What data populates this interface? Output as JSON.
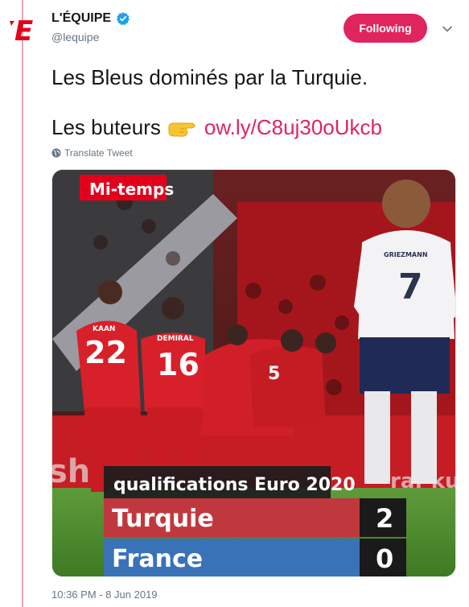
{
  "account": {
    "name": "L'ÉQUIPE",
    "handle": "@lequipe",
    "logo_text": "E",
    "verified_icon": "verified-badge-icon"
  },
  "actions": {
    "follow_label": "Following",
    "more_icon": "chevron-down-icon"
  },
  "tweet": {
    "line1": "Les Bleus dominés par la Turquie.",
    "line2_prefix": "Les buteurs",
    "line2_emoji_icon": "pointing-hand-icon",
    "link": "ow.ly/C8uj30oUkcb",
    "translate_label": "Translate Tweet",
    "timestamp": "10:36 PM - 8 Jun 2019"
  },
  "media": {
    "banner": "Mi-temps",
    "competition": "qualifications Euro 2020",
    "teams": [
      {
        "name": "Turquie",
        "score": "2",
        "color": "#c0383e"
      },
      {
        "name": "France",
        "score": "0",
        "color": "#3a72b8"
      }
    ],
    "players": [
      {
        "name": "KAAN",
        "number": "22"
      },
      {
        "name": "DEMIRAL",
        "number": "16"
      },
      {
        "name": "",
        "number": "5"
      },
      {
        "name": "GRIEZMANN",
        "number": "7"
      }
    ]
  },
  "colors": {
    "accent": "#e0245e",
    "thread": "#e6a9b3",
    "secondary_text": "#657786"
  }
}
